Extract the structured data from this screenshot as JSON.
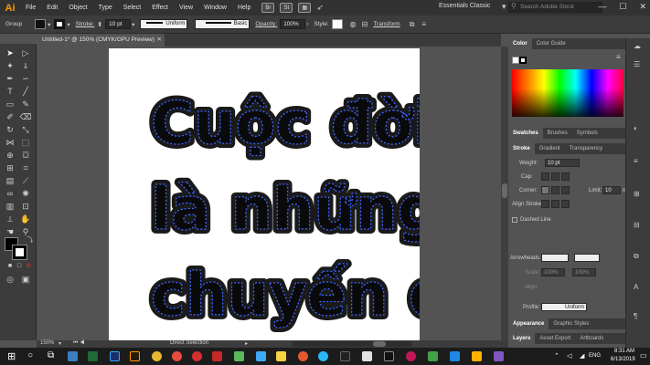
{
  "menubar": {
    "logo": "Ai",
    "items": [
      "File",
      "Edit",
      "Object",
      "Type",
      "Select",
      "Effect",
      "View",
      "Window",
      "Help"
    ],
    "bridge_icon": "Br",
    "stock_icon": "St",
    "workspace": "Essentials Classic",
    "search_placeholder": "Search Adobe Stock"
  },
  "controlbar": {
    "selection_label": "Group",
    "stroke_label": "Stroke:",
    "stroke_value": "10 pt",
    "profile_value": "Uniform",
    "brush_value": "Basic",
    "opacity_label": "Opacity:",
    "opacity_value": "100%",
    "style_label": "Style:",
    "transform_label": "Transform"
  },
  "document": {
    "tab_title": "Untitled-1* @ 150% (CMYK/GPU Preview)",
    "lines": [
      "Cuộc đời",
      "là những",
      "chuyến đi"
    ],
    "colors": {
      "fill": "#0a0a0a",
      "outline": "#1a1a1a",
      "dash": "#3b63ff"
    }
  },
  "statusbar": {
    "zoom": "150%",
    "tool": "Direct Selection"
  },
  "panels": {
    "color_tabs": [
      "Color",
      "Color Guide"
    ],
    "swatch_tabs": [
      "Swatches",
      "Brushes",
      "Symbols"
    ],
    "stroke_tabs": [
      "Stroke",
      "Gradient",
      "Transparency"
    ],
    "weight_label": "Weight:",
    "weight_value": "10 pt",
    "cap_label": "Cap:",
    "corner_label": "Corner:",
    "limit_label": "Limit:",
    "limit_value": "10",
    "limit_unit": "x",
    "align_label": "Align Stroke:",
    "dashed_label": "Dashed Line",
    "arrowheads_label": "Arrowheads:",
    "scale_label": "Scale:",
    "scale_value_1": "100%",
    "scale_value_2": "100%",
    "align_label_2": "Align:",
    "profile_label": "Profile:",
    "profile_value": "Uniform",
    "appearance_tabs": [
      "Appearance",
      "Graphic Styles"
    ],
    "layers_tabs": [
      "Layers",
      "Asset Export",
      "Artboards"
    ]
  },
  "taskbar": {
    "language": "ENG",
    "time": "8:31 AM",
    "date": "6/13/2019"
  }
}
